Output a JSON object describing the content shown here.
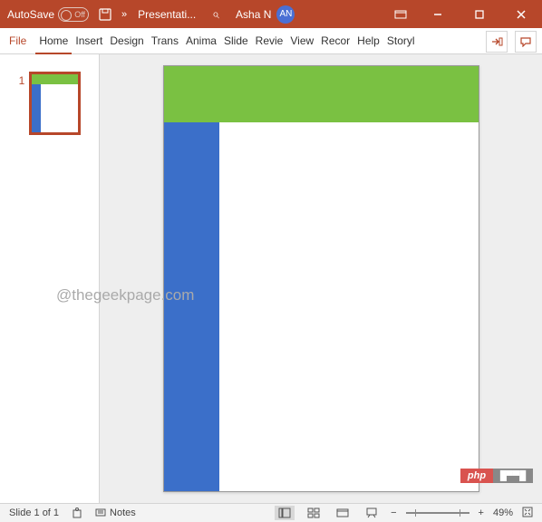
{
  "titlebar": {
    "autosave_label": "AutoSave",
    "autosave_state": "Off",
    "doc_name": "Presentati...",
    "user_name": "Asha N",
    "user_initials": "AN"
  },
  "ribbon": {
    "file": "File",
    "tabs": [
      "Home",
      "Insert",
      "Design",
      "Trans",
      "Anima",
      "Slide",
      "Revie",
      "View",
      "Recor",
      "Help",
      "Storyl"
    ]
  },
  "thumbs": {
    "first_num": "1"
  },
  "watermark": "@thegeekpage.com",
  "status": {
    "slide_info": "Slide 1 of 1",
    "notes_label": "Notes",
    "zoom_pct": "49%"
  },
  "badge": {
    "left": "php",
    "right": "█▀▀█"
  }
}
